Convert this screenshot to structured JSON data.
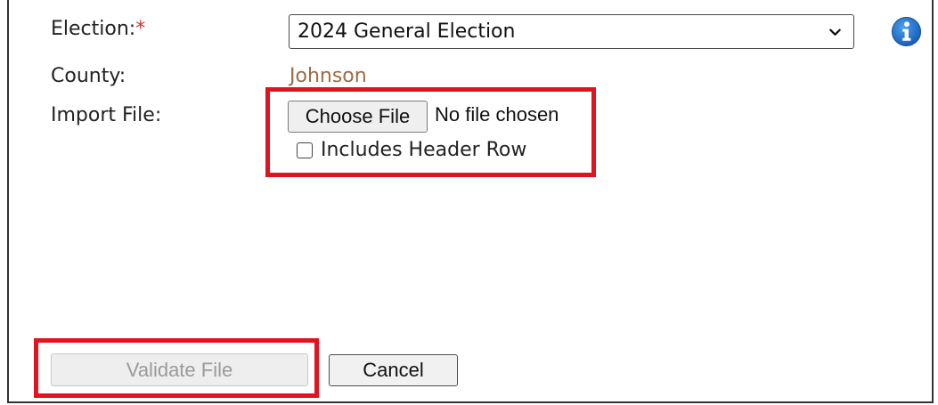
{
  "form": {
    "election_label": "Election:",
    "required_marker": "*",
    "election_selected": "2024 General Election",
    "county_label": "County:",
    "county_value": "Johnson",
    "import_label": "Import File:",
    "choose_file_label": "Choose File",
    "no_file_text": "No file chosen",
    "header_row_label": "Includes Header Row",
    "header_row_checked": false
  },
  "actions": {
    "validate_label": "Validate File",
    "validate_disabled": true,
    "cancel_label": "Cancel"
  },
  "icons": {
    "info": "info-icon",
    "dropdown": "chevron-down-icon"
  },
  "colors": {
    "required": "#d32f2f",
    "county_value": "#9c6b45",
    "info_blue": "#1f6fc9",
    "callout_red": "#e0141e"
  }
}
